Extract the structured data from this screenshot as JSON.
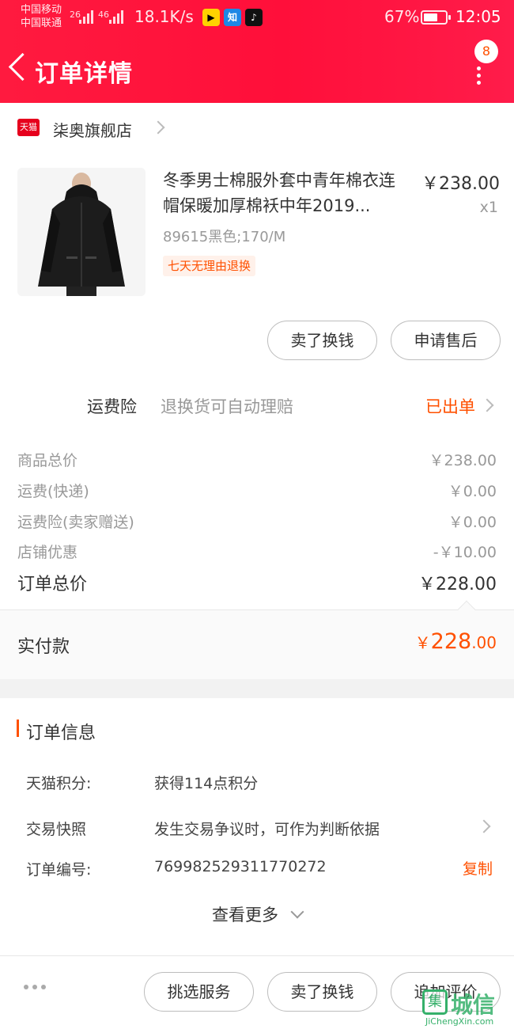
{
  "status_bar": {
    "carrier_1": "中国移动",
    "carrier_2": "中国联通",
    "net_1": "26",
    "net_2": "46",
    "speed": "18.1K/s",
    "battery": "67%",
    "battery_level": 0.67,
    "time": "12:05",
    "app_icons": [
      "tencent-video-icon",
      "zhihu-icon",
      "tiktok-icon"
    ],
    "zhihu_glyph": "知"
  },
  "header": {
    "title": "订单详情",
    "badge_count": "8",
    "background": "#ff1a3f"
  },
  "store": {
    "logo_text": "天猫",
    "name": "柒奥旗舰店"
  },
  "product": {
    "title": "冬季男士棉服外套中青年棉衣连帽保暖加厚棉袄中年2019...",
    "price": "￥238.00",
    "qty": "x1",
    "sku": "89615黑色;170/M",
    "tag": "七天无理由退换",
    "buttons": [
      "卖了换钱",
      "申请售后"
    ]
  },
  "insurance": {
    "label": "运费险",
    "desc": "退换货可自动理赔",
    "status": "已出单"
  },
  "fees": [
    {
      "label": "商品总价",
      "value": "￥238.00"
    },
    {
      "label": "运费(快递)",
      "value": "￥0.00"
    },
    {
      "label": "运费险(卖家赠送)",
      "value": "￥0.00"
    },
    {
      "label": "店铺优惠",
      "value": "-￥10.00"
    }
  ],
  "total": {
    "label": "订单总价",
    "value": "￥228.00"
  },
  "paid": {
    "label": "实付款",
    "currency": "￥",
    "int": "228",
    "dec": ".00"
  },
  "order_info": {
    "title": "订单信息",
    "rows": [
      {
        "key": "天猫积分:",
        "value": "获得114点积分"
      },
      {
        "key": "交易快照",
        "value": "发生交易争议时，可作为判断依据"
      },
      {
        "key": "订单编号:",
        "value": "769982529311770272"
      }
    ],
    "copy": "复制",
    "see_more": "查看更多"
  },
  "bottom_bar": {
    "buttons": [
      "挑选服务",
      "卖了换钱",
      "追加评价"
    ]
  },
  "watermark": {
    "logo": "集",
    "text": "城信",
    "sub": "JiChengXin.com"
  },
  "colors": {
    "accent": "#ff5000",
    "brand_red": "#ff1a3f"
  }
}
